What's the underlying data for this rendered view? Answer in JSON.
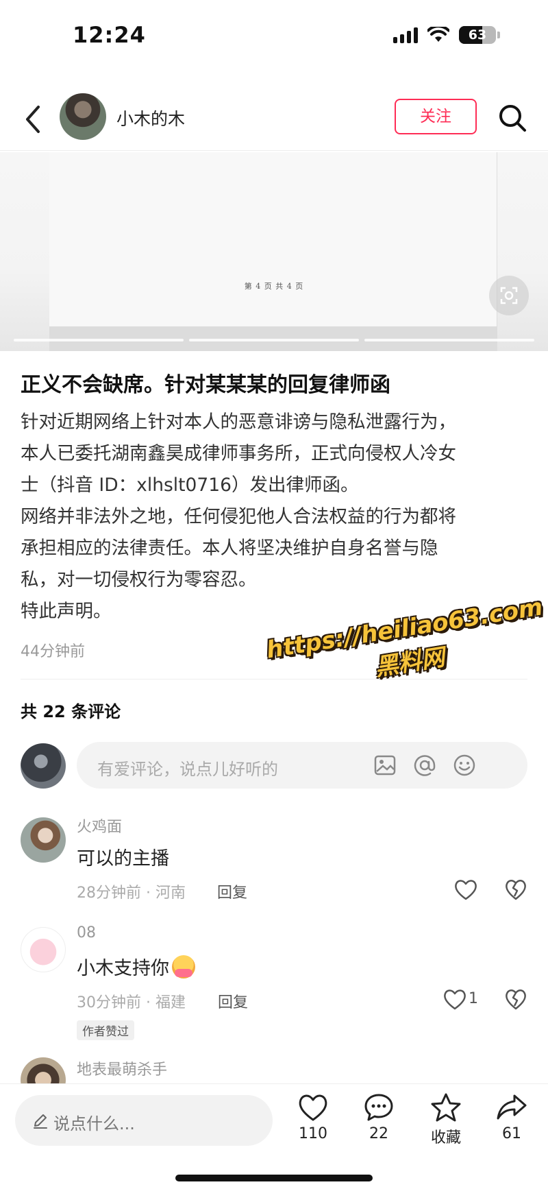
{
  "status_bar": {
    "time": "12:24",
    "battery": "63",
    "battery_level": 0.63
  },
  "header": {
    "author_name": "小木的木",
    "follow_label": "关注"
  },
  "image": {
    "page_indicator": "第 4 页 共 4 页",
    "slide_count": 3
  },
  "post": {
    "title": "正义不会缺席。针对某某某的回复律师函",
    "lines": [
      "针对近期网络上针对本人的恶意诽谤与隐私泄露行为，",
      "本人已委托湖南鑫昊成律师事务所，正式向侵权人冷女",
      "士（抖音 ID：xlhslt0716）发出律师函。",
      "网络并非法外之地，任何侵犯他人合法权益的行为都将",
      "承担相应的法律责任。本人将坚决维护自身名誉与隐",
      "私，对一切侵权行为零容忍。",
      "特此声明。"
    ],
    "time": "44分钟前"
  },
  "watermark": {
    "url": "https://heiliao63.com",
    "name": "黑料网"
  },
  "comments_section": {
    "count_label": "共 22 条评论",
    "input_placeholder": "有爱评论，说点儿好听的",
    "comments": [
      {
        "user": "火鸡面",
        "text": "可以的主播",
        "meta": "28分钟前 · 河南",
        "reply": "回复",
        "likes": ""
      },
      {
        "user": "08",
        "text": "小木支持你",
        "meta": "30分钟前 · 福建",
        "reply": "回复",
        "likes": "1",
        "badge": "作者赞过"
      },
      {
        "user": "地表最萌杀手"
      }
    ]
  },
  "bottom_bar": {
    "input_placeholder": "说点什么...",
    "like_count": "110",
    "comment_count": "22",
    "favorite_label": "收藏",
    "share_count": "61"
  },
  "colors": {
    "accent": "#fe2c55",
    "watermark": "#f6c33a"
  }
}
